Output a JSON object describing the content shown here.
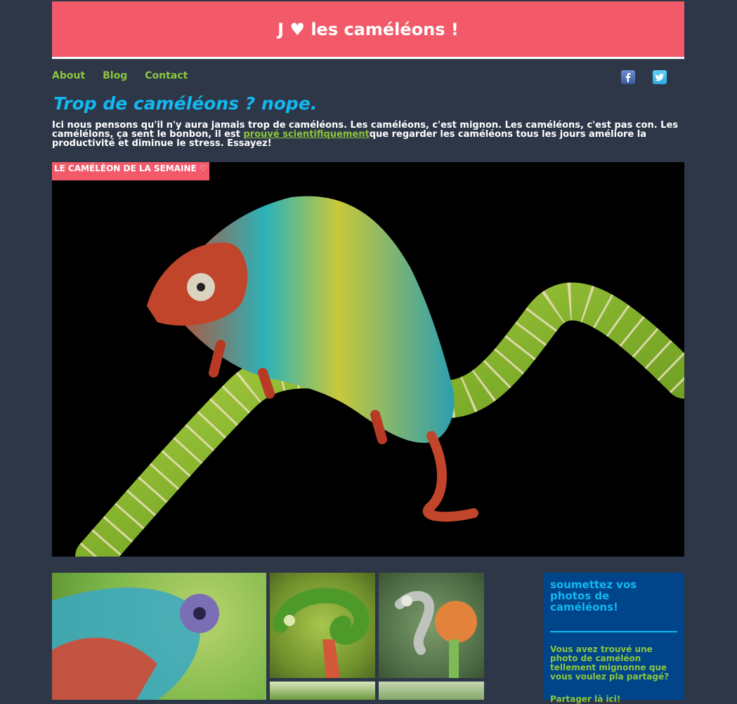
{
  "header": {
    "title": "J ♥ les caméléons !"
  },
  "nav": {
    "items": [
      "About",
      "Blog",
      "Contact"
    ]
  },
  "social": {
    "facebook": "facebook-icon",
    "twitter": "twitter-icon"
  },
  "main": {
    "tagline": "Trop de caméléons ? nope.",
    "intro_before": "Ici nous pensons qu'il n'y aura jamais trop de caméléons. Les caméléons, c'est mignon. Les caméléons, c'est pas con. Les camélélons, ça sent le bonbon, il est ",
    "intro_link": "prouvé scientifiquement",
    "intro_after": "que regarder les caméléons tous les jours améliore la productivité et diminue le stress. Essayez!"
  },
  "hero": {
    "badge": "LE CAMÉLÉON DE LA SEMAINE ♡"
  },
  "submit": {
    "title": "soumettez vos photos de caméléons!",
    "text": "Vous avez trouvé une photo de caméléon tellement mignonne que vous voulez pla partagé?",
    "link": "Partager là ici!"
  },
  "colors": {
    "background": "#2e3748",
    "accent_pink": "#f25a6a",
    "accent_green": "#8cc63f",
    "accent_blue": "#12b8f2",
    "panel_blue": "#00448a"
  }
}
